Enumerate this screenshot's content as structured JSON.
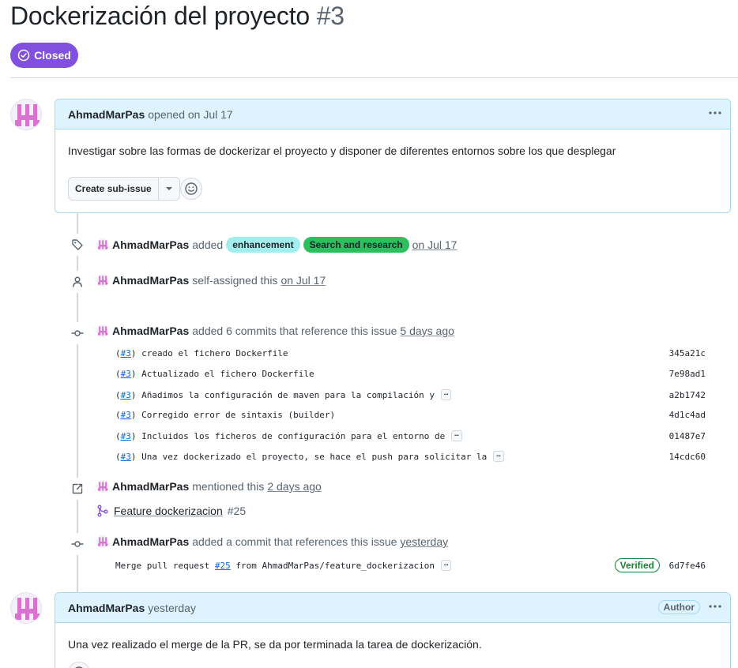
{
  "issue": {
    "title": "Dockerización del proyecto",
    "number": "#3",
    "state": "Closed",
    "state_color": "#8250df"
  },
  "first_comment": {
    "author": "AhmadMarPas",
    "action": "opened on Jul 17",
    "body": "Investigar sobre las formas de dockerizar el proyecto y disponer de diferentes entornos sobre los que desplegar",
    "create_sub_issue": "Create sub-issue",
    "menu_icon": "kebab-horizontal-icon",
    "reaction_icon": "smiley-icon"
  },
  "events": {
    "labels_event": {
      "icon": "tag-icon",
      "author": "AhmadMarPas",
      "action": "added",
      "labels": [
        {
          "name": "enhancement",
          "bg": "#a2eeef"
        },
        {
          "name": "Search and research",
          "bg": "#2bbf5e"
        }
      ],
      "time": "on Jul 17"
    },
    "assign_event": {
      "icon": "person-icon",
      "author": "AhmadMarPas",
      "action": "self-assigned this",
      "time": "on Jul 17"
    },
    "commits_event": {
      "icon": "git-commit-icon",
      "author": "AhmadMarPas",
      "action": "added 6 commits that reference this issue",
      "time": "5 days ago",
      "commits": [
        {
          "ref": "#3",
          "message": "creado el fichero Dockerfile",
          "truncated": false,
          "sha": "345a21c"
        },
        {
          "ref": "#3",
          "message": "Actualizado el fichero Dockerfile",
          "truncated": false,
          "sha": "7e98ad1"
        },
        {
          "ref": "#3",
          "message": "Añadimos la configuración de maven para la compilación y",
          "truncated": true,
          "sha": "a2b1742"
        },
        {
          "ref": "#3",
          "message": "Corregido error de sintaxis (builder)",
          "truncated": false,
          "sha": "4d1c4ad"
        },
        {
          "ref": "#3",
          "message": "Incluidos los ficheros de configuración para el entorno de",
          "truncated": true,
          "sha": "01487e7"
        },
        {
          "ref": "#3",
          "message": "Una vez dockerizado el proyecto, se hace el push para solicitar la",
          "truncated": true,
          "sha": "14cdc60"
        }
      ]
    },
    "mention_event": {
      "icon": "cross-reference-icon",
      "author": "AhmadMarPas",
      "action": "mentioned this",
      "time": "2 days ago",
      "pr_title": "Feature dockerizacion",
      "pr_number": "#25"
    },
    "commit_event": {
      "icon": "git-commit-icon",
      "author": "AhmadMarPas",
      "action": "added a commit that references this issue",
      "time": "yesterday",
      "commit_prefix": "Merge pull request ",
      "commit_ref": "#25",
      "commit_suffix": " from AhmadMarPas/feature_dockerizacion",
      "verified": "Verified",
      "sha": "6d7fe46"
    }
  },
  "second_comment": {
    "author": "AhmadMarPas",
    "time": "yesterday",
    "badge": "Author",
    "body": "Una vez realizado el merge de la PR, se da por terminada la tarea de dockerización."
  },
  "hidden_text_label": "…"
}
